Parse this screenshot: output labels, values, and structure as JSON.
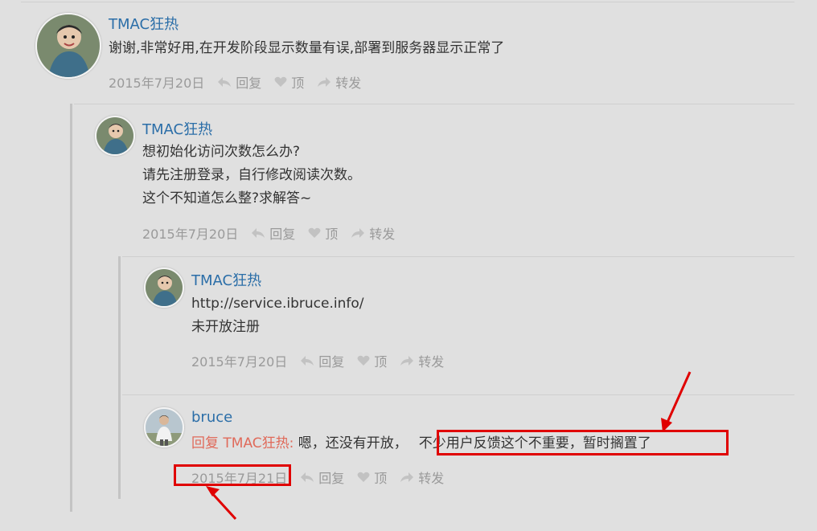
{
  "colors": {
    "background": "#e0e0e0",
    "author": "#2b6ea8",
    "meta": "#9a9a9a",
    "reply_prefix": "#e06a5a",
    "annotation": "#e00000"
  },
  "actions": {
    "reply": "回复",
    "like": "顶",
    "share": "转发"
  },
  "comments": [
    {
      "author": "TMAC狂热",
      "lines": [
        "谢谢,非常好用,在开发阶段显示数量有误,部署到服务器显示正常了"
      ],
      "date": "2015年7月20日"
    },
    {
      "author": "TMAC狂热",
      "lines": [
        "想初始化访问次数怎么办?",
        "请先注册登录，自行修改阅读次数。",
        "这个不知道怎么整?求解答~"
      ],
      "date": "2015年7月20日"
    },
    {
      "author": "TMAC狂热",
      "lines": [
        "http://service.ibruce.info/",
        "未开放注册"
      ],
      "date": "2015年7月20日"
    },
    {
      "author": "bruce",
      "reply_prefix": "回复 TMAC狂热:",
      "text_before": " 嗯，还没有开放，",
      "text_highlight": "不少用户反馈这个不重要，暂时搁置了",
      "date": "2015年7月21日"
    }
  ]
}
